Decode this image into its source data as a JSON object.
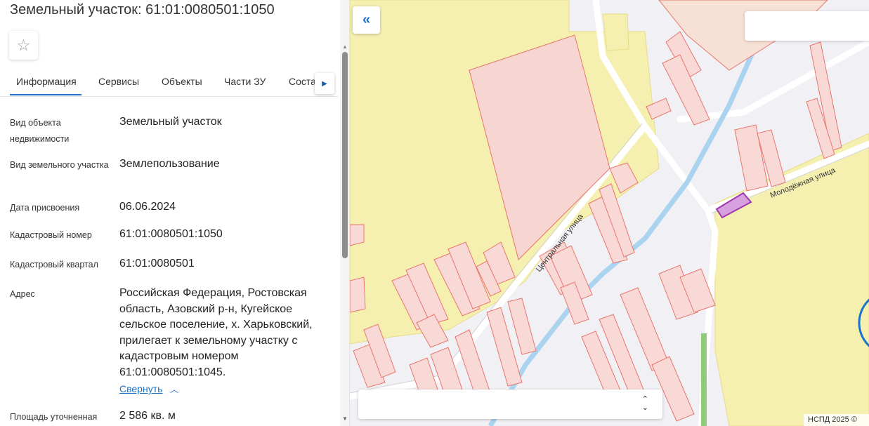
{
  "header": {
    "title": "Земельный участок: 61:01:0080501:1050",
    "close_icon": "close-icon",
    "favorite_icon": "star-icon"
  },
  "tabs": [
    {
      "label": "Информация",
      "active": true
    },
    {
      "label": "Сервисы"
    },
    {
      "label": "Объекты"
    },
    {
      "label": "Части ЗУ"
    },
    {
      "label": "Соста"
    }
  ],
  "info": {
    "object_type": {
      "label": "Вид объекта недвижимости",
      "value": "Земельный участок"
    },
    "land_type": {
      "label": "Вид земельного участка",
      "value": "Землепользование"
    },
    "assign_date": {
      "label": "Дата присвоения",
      "value": "06.06.2024"
    },
    "cadastral_number": {
      "label": "Кадастровый номер",
      "value": "61:01:0080501:1050"
    },
    "cadastral_quarter": {
      "label": "Кадастровый квартал",
      "value": "61:01:0080501"
    },
    "address": {
      "label": "Адрес",
      "value": "Российская Федерация, Ростовская область, Азовский р-н, Кугейское сельское поселение, х. Харьковский, прилегает к земельному участку с кадастровым номером 61:01:0080501:1045."
    },
    "collapse_link": "Свернуть",
    "area": {
      "label": "Площадь уточненная",
      "value": "2 586 кв. м"
    }
  },
  "map": {
    "road_central": "Центральная улица",
    "road_youth": "Молодёжная улица",
    "copyright": "НСПД 2025 ©",
    "colors": {
      "parcel_fill": "#f9d9d6",
      "parcel_stroke": "#e8766e",
      "zone_fill": "#f6f0b0",
      "river": "#a9d3ef",
      "selected": "#a033b0"
    }
  }
}
